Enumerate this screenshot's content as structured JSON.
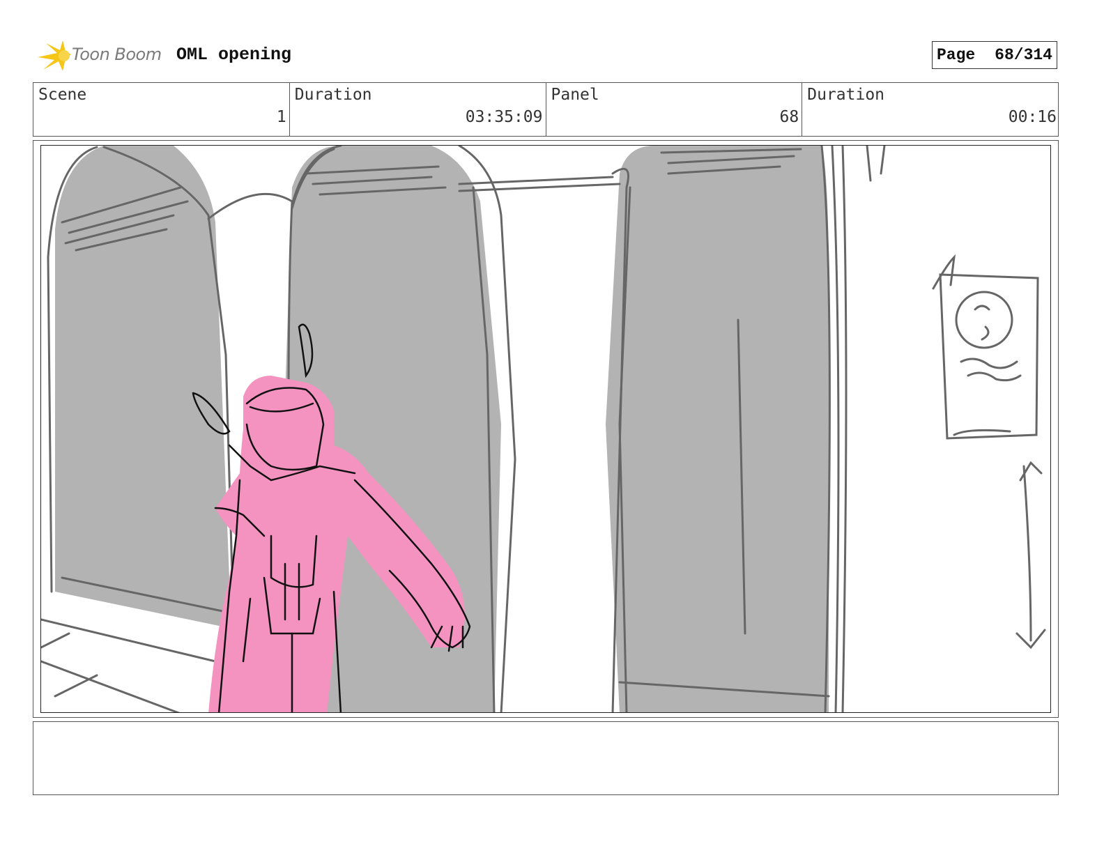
{
  "header": {
    "logo_text": "Toon Boom",
    "project_title": "OML opening",
    "page_label": "Page",
    "page_number": "68/314"
  },
  "info": {
    "scene_label": "Scene",
    "scene_value": "1",
    "scene_duration_label": "Duration",
    "scene_duration_value": "03:35:09",
    "panel_label": "Panel",
    "panel_value": "68",
    "panel_duration_label": "Duration",
    "panel_duration_value": "00:16"
  },
  "colors": {
    "logo_accent": "#f5c518",
    "shadow_gray": "#b3b3b3",
    "sketch_line": "#666666",
    "character_pink": "#f493c0"
  },
  "caption": ""
}
